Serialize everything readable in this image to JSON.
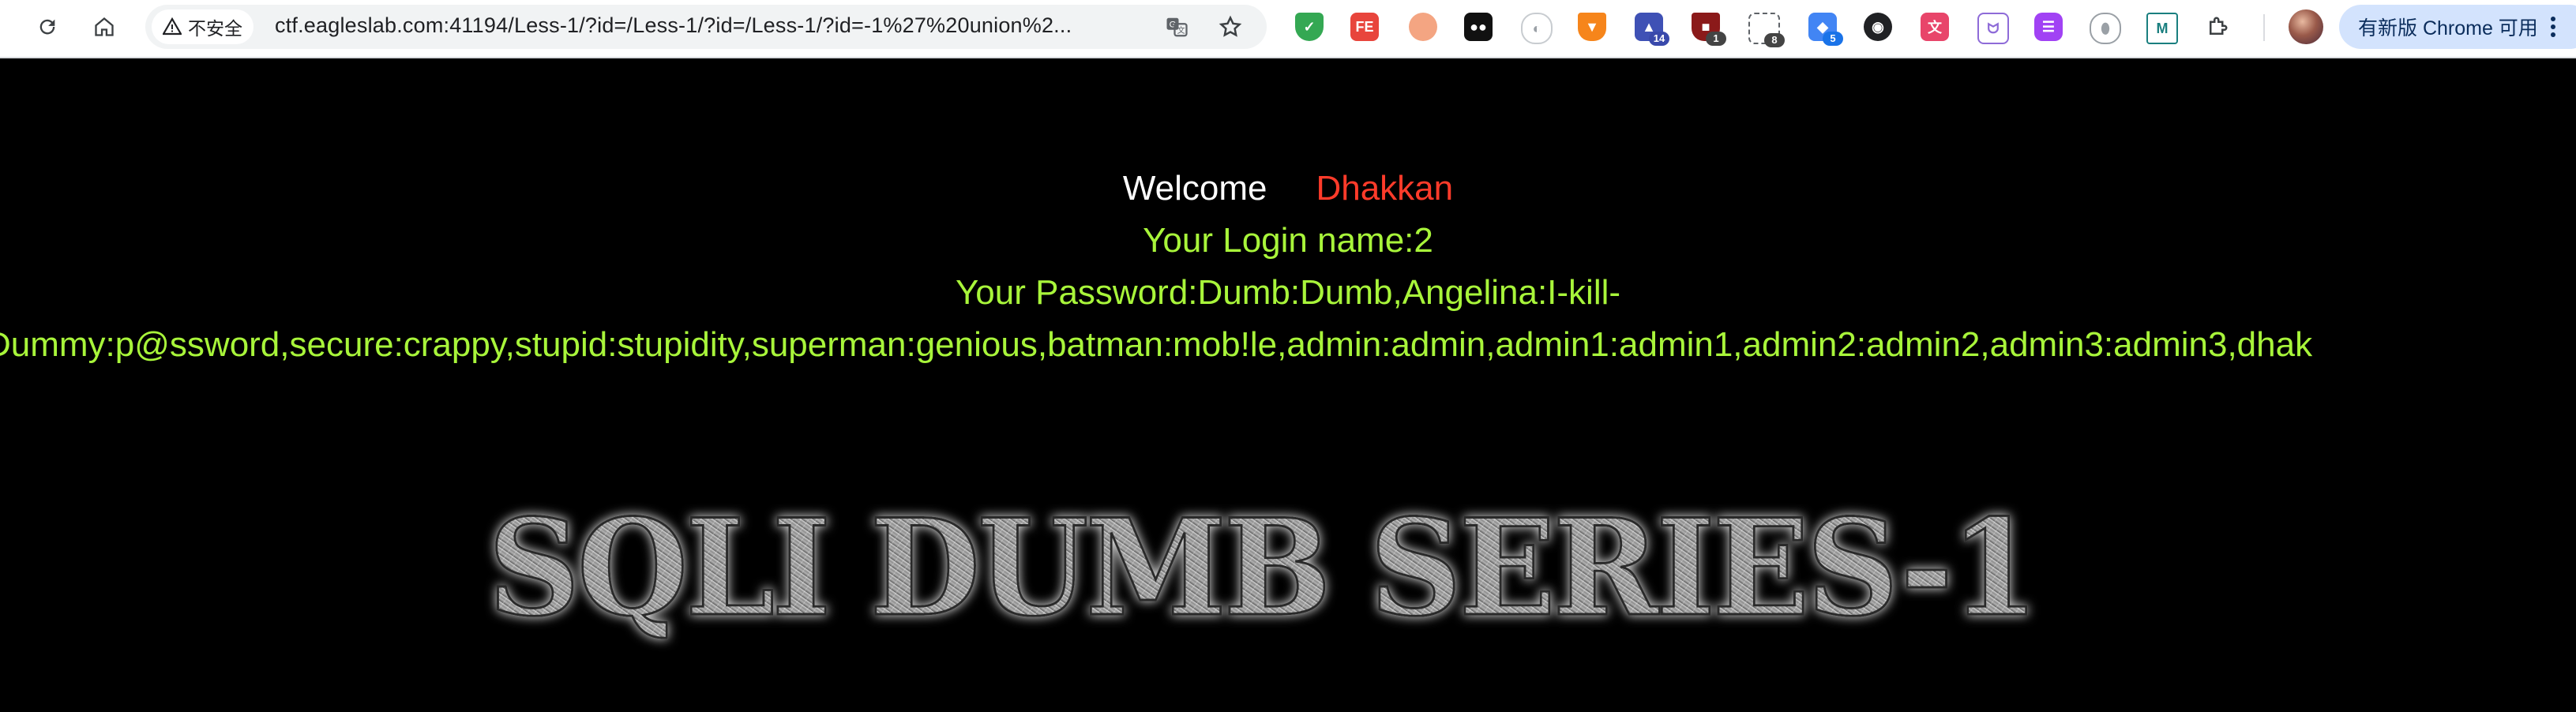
{
  "browser": {
    "security_label": "不安全",
    "url": "ctf.eagleslab.com:41194/Less-1/?id=/Less-1/?id=/Less-1/?id=-1%27%20union%2...",
    "update_button_label": "有新版 Chrome 可用",
    "extensions": [
      {
        "icon": "shield-check-icon",
        "color": "#34a853"
      },
      {
        "icon": "fe-helper-icon",
        "color": "#e8453c",
        "label": "FE"
      },
      {
        "icon": "circle-icon",
        "color": "#f4a582"
      },
      {
        "icon": "ghost-icon",
        "color": "#111111"
      },
      {
        "icon": "planet-icon",
        "color": "#9aa0a6"
      },
      {
        "icon": "fox-icon",
        "color": "#f6851b"
      },
      {
        "icon": "graduation-cap-icon",
        "color": "#3f51b5",
        "badge": "14"
      },
      {
        "icon": "shield-red-icon",
        "color": "#8b1a1a",
        "badge": "1"
      },
      {
        "icon": "crop-icon",
        "color": "#5f6368",
        "badge": "8"
      },
      {
        "icon": "cubes-icon",
        "color": "#4285f4",
        "badge": "5"
      },
      {
        "icon": "github-icon",
        "color": "#202124"
      },
      {
        "icon": "translate-icon",
        "color": "#e8456a"
      },
      {
        "icon": "cat-icon",
        "color": "#8e6bd8"
      },
      {
        "icon": "chat-icon",
        "color": "#a142f4"
      },
      {
        "icon": "js-icon",
        "color": "#9aa0a6"
      },
      {
        "icon": "m-icon",
        "color": "#1a7f7f",
        "label": "M"
      },
      {
        "icon": "puzzle-icon",
        "color": "#5f6368"
      }
    ]
  },
  "page": {
    "welcome_word": "Welcome",
    "welcome_name": "Dhakkan",
    "login_line": "Your Login name:2",
    "password_line_1": "Your Password:Dumb:Dumb,Angelina:I-kill-",
    "password_line_2": "Dummy:p@ssword,secure:crappy,stupid:stupidity,superman:genious,batman:mob!le,admin:admin,admin1:admin1,admin2:admin2,admin3:admin3,dhak",
    "banner": "SQLI DUMB SERIES-1"
  }
}
